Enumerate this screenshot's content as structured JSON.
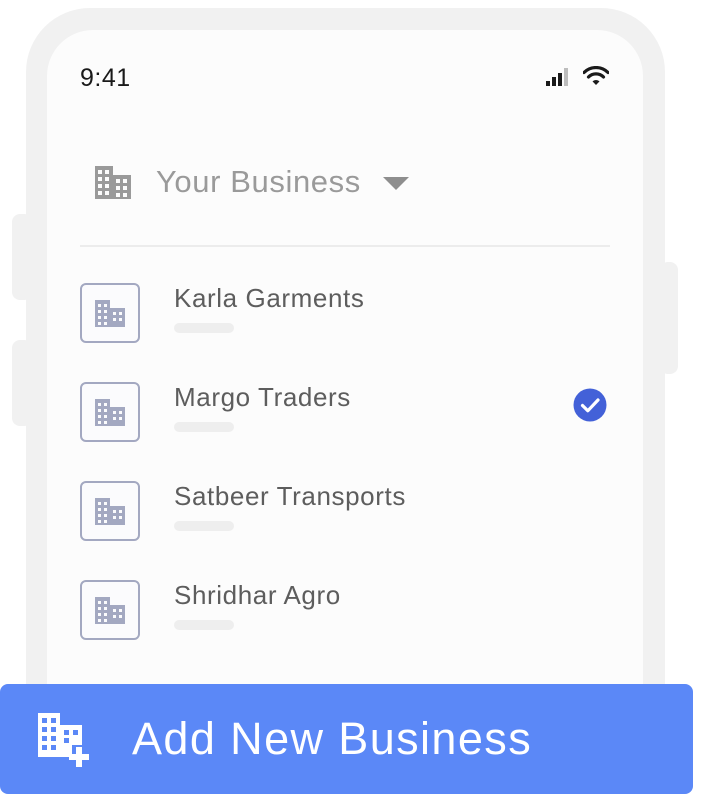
{
  "status_bar": {
    "time": "9:41"
  },
  "header": {
    "title": "Your Business"
  },
  "businesses": [
    {
      "name": "Karla Garments",
      "selected": false
    },
    {
      "name": "Margo Traders",
      "selected": true
    },
    {
      "name": "Satbeer Transports",
      "selected": false
    },
    {
      "name": "Shridhar Agro",
      "selected": false
    }
  ],
  "add_button": {
    "label": "Add New Business"
  },
  "colors": {
    "accent": "#5b88f7",
    "check": "#4361d8",
    "icon_stroke": "#a3a8c1",
    "header_icon": "#9a9a9a"
  },
  "icons": {
    "business": "building-icon",
    "selected": "check-circle-icon",
    "add": "building-add-icon",
    "dropdown": "chevron-down-icon"
  }
}
